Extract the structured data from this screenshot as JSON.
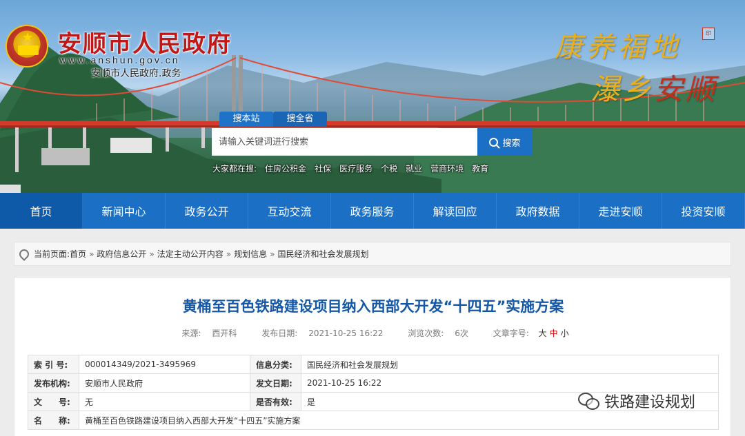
{
  "header": {
    "site_title": "安顺市人民政府",
    "site_url": "www.anshun.gov.cn",
    "site_subtitle": "安顺市人民政府.政务",
    "slogan_line1": "康养福地",
    "slogan_line2_a": "瀑乡",
    "slogan_line2_b": "安顺"
  },
  "search": {
    "tabs": [
      "搜本站",
      "搜全省"
    ],
    "placeholder": "请输入关键词进行搜索",
    "button_label": "搜索",
    "hot_label": "大家都在搜:",
    "hot_terms": [
      "住房公积金",
      "社保",
      "医疗服务",
      "个税",
      "就业",
      "营商环境",
      "教育"
    ]
  },
  "nav": {
    "items": [
      "首页",
      "新闻中心",
      "政务公开",
      "互动交流",
      "政务服务",
      "解读回应",
      "政府数据",
      "走进安顺",
      "投资安顺"
    ],
    "active_index": 0
  },
  "breadcrumb": {
    "prefix": "当前页面:",
    "items": [
      "首页",
      "政府信息公开",
      "法定主动公开内容",
      "规划信息",
      "国民经济和社会发展规划"
    ],
    "separator": "»"
  },
  "article": {
    "title": "黄桶至百色铁路建设项目纳入西部大开发“十四五”实施方案",
    "source_label": "来源:",
    "source": "西开科",
    "date_label": "发布日期:",
    "date": "2021-10-25 16:22",
    "views_label": "浏览次数:",
    "views": "6次",
    "fontsize_label": "文章字号:",
    "fontsize_large": "大",
    "fontsize_medium": "中",
    "fontsize_small": "小"
  },
  "info_table": {
    "rows": [
      {
        "k1": "索 引 号:",
        "v1": "000014349/2021-3495969",
        "k2": "信息分类:",
        "v2": "国民经济和社会发展规划"
      },
      {
        "k1": "发布机构:",
        "v1": "安顺市人民政府",
        "k2": "发文日期:",
        "v2": "2021-10-25 16:22"
      },
      {
        "k1": "文　　号:",
        "v1": "无",
        "k2": "是否有效:",
        "v2": "是"
      }
    ],
    "name_label": "名　　称:",
    "name_value": "黄桶至百色铁路建设项目纳入西部大开发“十四五”实施方案"
  },
  "watermark": {
    "text": "铁路建设规划"
  },
  "colors": {
    "primary_blue": "#1b6fc4",
    "title_blue": "#1457a6",
    "site_title_red": "#c01818",
    "bridge_red": "#d63a2a"
  }
}
